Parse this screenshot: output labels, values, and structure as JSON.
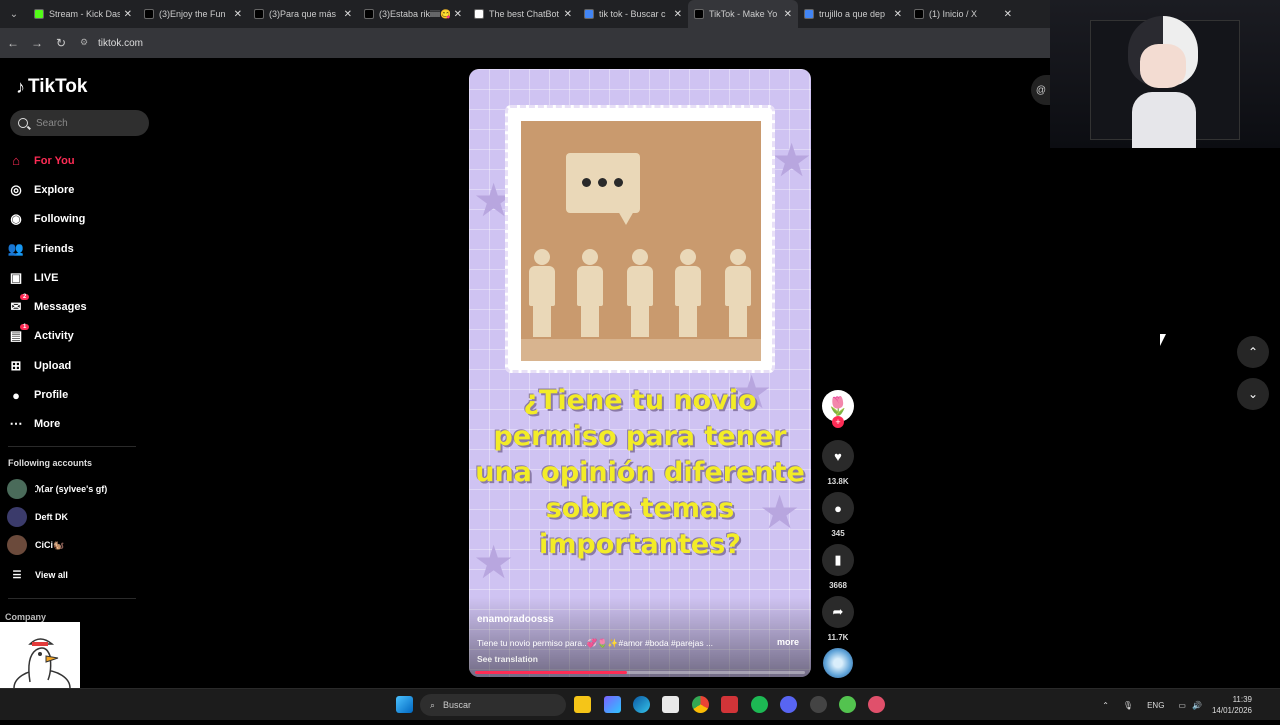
{
  "browser": {
    "tabs": [
      {
        "title": "Stream - Kick Das",
        "icon": "kick-icon",
        "color": "#53fc18"
      },
      {
        "title": "(3)Enjoy the Fun",
        "icon": "tiktok-icon",
        "color": "#000000"
      },
      {
        "title": "(3)Para que más",
        "icon": "tiktok-icon",
        "color": "#000000"
      },
      {
        "title": "(3)Estaba rikiiiii😋",
        "icon": "tiktok-icon",
        "color": "#000000"
      },
      {
        "title": "The best ChatBot",
        "icon": "chatbot-icon",
        "color": "#ffffff"
      },
      {
        "title": "tik tok - Buscar c",
        "icon": "google-icon",
        "color": "#4285f4"
      },
      {
        "title": "TikTok - Make Yo",
        "icon": "tiktok-icon",
        "color": "#000000",
        "active": true
      },
      {
        "title": "trujillo a que dep",
        "icon": "google-icon",
        "color": "#4285f4"
      },
      {
        "title": "(1) Inicio / X",
        "icon": "x-icon",
        "color": "#000000"
      }
    ],
    "url": "tiktok.com"
  },
  "sidebar": {
    "logo": "TikTok",
    "search_placeholder": "Search",
    "nav": [
      {
        "label": "For You",
        "icon": "home-icon",
        "selected": true
      },
      {
        "label": "Explore",
        "icon": "compass-icon"
      },
      {
        "label": "Following",
        "icon": "following-avatar-icon"
      },
      {
        "label": "Friends",
        "icon": "friends-icon"
      },
      {
        "label": "LIVE",
        "icon": "live-icon"
      },
      {
        "label": "Messages",
        "icon": "messages-icon",
        "badge": "2"
      },
      {
        "label": "Activity",
        "icon": "activity-icon",
        "badge": "1"
      },
      {
        "label": "Upload",
        "icon": "upload-icon"
      },
      {
        "label": "Profile",
        "icon": "profile-icon"
      },
      {
        "label": "More",
        "icon": "more-icon"
      }
    ],
    "following_title": "Following accounts",
    "following_accounts": [
      {
        "name": "ℳar (sylvee's gf)"
      },
      {
        "name": "Deft DK"
      },
      {
        "name": "CiCi🐿️"
      }
    ],
    "view_all": "View all",
    "company": "Company"
  },
  "video": {
    "overlay_text": "¿Tiene tu novio permiso para tener una opinión diferente sobre temas importantes?",
    "username": "enamoradoosss",
    "description": "Tiene tu novio permiso para..💞🌷✨#amor #boda #parejas ...",
    "more": "more",
    "see_translation": "See translation",
    "progress": 0.46
  },
  "actions": {
    "likes": "13.8K",
    "comments": "345",
    "saves": "3668",
    "shares": "11.7K"
  },
  "taskbar": {
    "search_placeholder": "Buscar",
    "language": "ENG",
    "time": "11:39",
    "date": "14/01/2026"
  }
}
